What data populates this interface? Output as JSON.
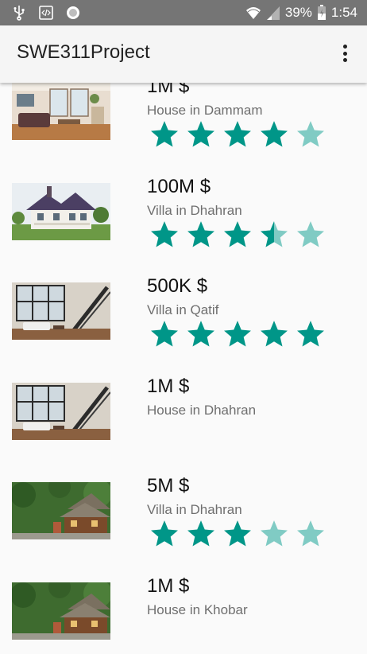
{
  "status_bar": {
    "battery_percent": "39%",
    "time": "1:54",
    "icons": [
      "usb-icon",
      "code-icon",
      "circle-icon",
      "wifi-icon",
      "signal-icon",
      "battery-icon"
    ]
  },
  "app_bar": {
    "title": "SWE311Project",
    "menu_icon": "more-vert-icon"
  },
  "colors": {
    "star_filled": "#009688",
    "star_empty": "#80cbc4",
    "status_bar": "#757575",
    "app_bar": "#f5f5f5"
  },
  "listings": [
    {
      "price": "1M $",
      "subtitle": "House in Dammam",
      "rating": 4,
      "image": "living-room-photo"
    },
    {
      "price": "100M $",
      "subtitle": "Villa in Dhahran",
      "rating": 3.5,
      "image": "victorian-villa-photo"
    },
    {
      "price": "500K $",
      "subtitle": "Villa in Qatif",
      "rating": 5,
      "image": "loft-interior-photo"
    },
    {
      "price": "1M $",
      "subtitle": "House in Dhahran",
      "rating": 0,
      "image": "loft-interior-photo"
    },
    {
      "price": "5M $",
      "subtitle": "Villa in Dhahran",
      "rating": 3,
      "image": "forest-lodge-photo"
    },
    {
      "price": "1M $",
      "subtitle": "House in Khobar",
      "rating": 0,
      "image": "forest-lodge-photo"
    }
  ]
}
